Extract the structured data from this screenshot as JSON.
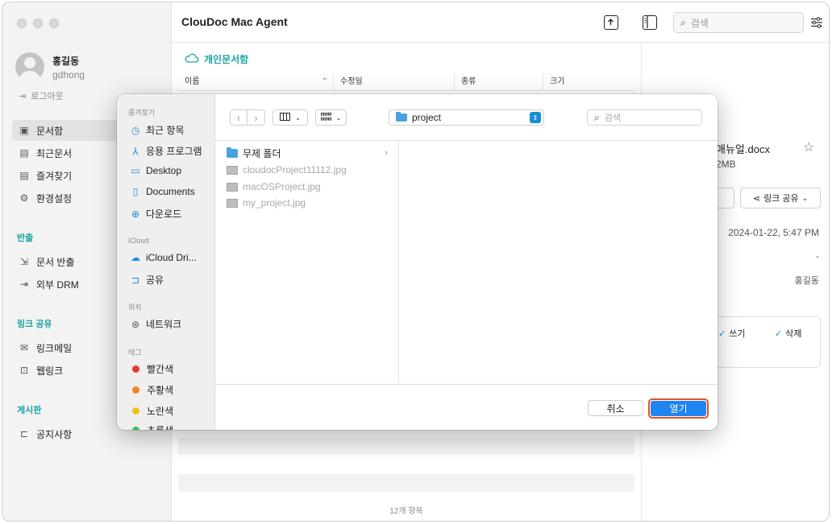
{
  "app": {
    "title": "ClouDoc Mac Agent"
  },
  "user": {
    "name": "홍길동",
    "id": "gdhong",
    "logout": "로그아웃"
  },
  "sidebar": {
    "items": [
      {
        "label": "문서함",
        "icon": "document-box-icon"
      },
      {
        "label": "최근문서",
        "icon": "recent-doc-icon"
      },
      {
        "label": "즐겨찾기",
        "icon": "favorite-doc-icon"
      },
      {
        "label": "환경설정",
        "icon": "gear-icon"
      }
    ],
    "sections": [
      {
        "title": "반출",
        "items": [
          {
            "label": "문서 반출"
          },
          {
            "label": "외부 DRM"
          }
        ]
      },
      {
        "title": "링크 공유",
        "items": [
          {
            "label": "링크메일"
          },
          {
            "label": "웹링크"
          }
        ]
      },
      {
        "title": "게시판",
        "items": [
          {
            "label": "공지사항"
          }
        ]
      }
    ]
  },
  "toolbar": {
    "search_placeholder": "검색"
  },
  "main": {
    "breadcrumb": "개인문서함",
    "columns": [
      "이름",
      "수정일",
      "종류",
      "크기"
    ],
    "footer": "12개 항목"
  },
  "details": {
    "file_name": "매뉴얼.docx",
    "file_size": "2MB",
    "share_label": "링크 공유",
    "modified": "2024-01-22, 5:47 PM",
    "dash": "-",
    "owner": "홍길동",
    "perm_write": "쓰기",
    "perm_delete": "삭제"
  },
  "dialog": {
    "favorites_title": "즐겨찾기",
    "favorites": [
      {
        "label": "최근 항목",
        "icon": "clock-icon"
      },
      {
        "label": "응용 프로그램",
        "icon": "applications-icon"
      },
      {
        "label": "Desktop",
        "icon": "desktop-icon"
      },
      {
        "label": "Documents",
        "icon": "document-icon"
      },
      {
        "label": "다운로드",
        "icon": "download-icon"
      }
    ],
    "icloud_title": "iCloud",
    "icloud": [
      {
        "label": "iCloud Dri...",
        "icon": "cloud-icon"
      },
      {
        "label": "공유",
        "icon": "shared-folder-icon"
      }
    ],
    "location_title": "위치",
    "locations": [
      {
        "label": "네트워크",
        "icon": "network-icon"
      }
    ],
    "tags_title": "태그",
    "tags": [
      {
        "label": "빨간색",
        "color": "#e83a30"
      },
      {
        "label": "주황색",
        "color": "#f0861f"
      },
      {
        "label": "노란색",
        "color": "#f2c21c"
      },
      {
        "label": "초록색",
        "color": "#3fb950"
      }
    ],
    "path": "project",
    "search_placeholder": "검색",
    "files": [
      {
        "name": "무제 폴더",
        "type": "folder",
        "enabled": true
      },
      {
        "name": "cloudocProject11112.jpg",
        "type": "image",
        "enabled": false
      },
      {
        "name": "macOSProject.jpg",
        "type": "image",
        "enabled": false
      },
      {
        "name": "my_project.jpg",
        "type": "image",
        "enabled": false
      }
    ],
    "cancel": "취소",
    "open": "열기"
  }
}
